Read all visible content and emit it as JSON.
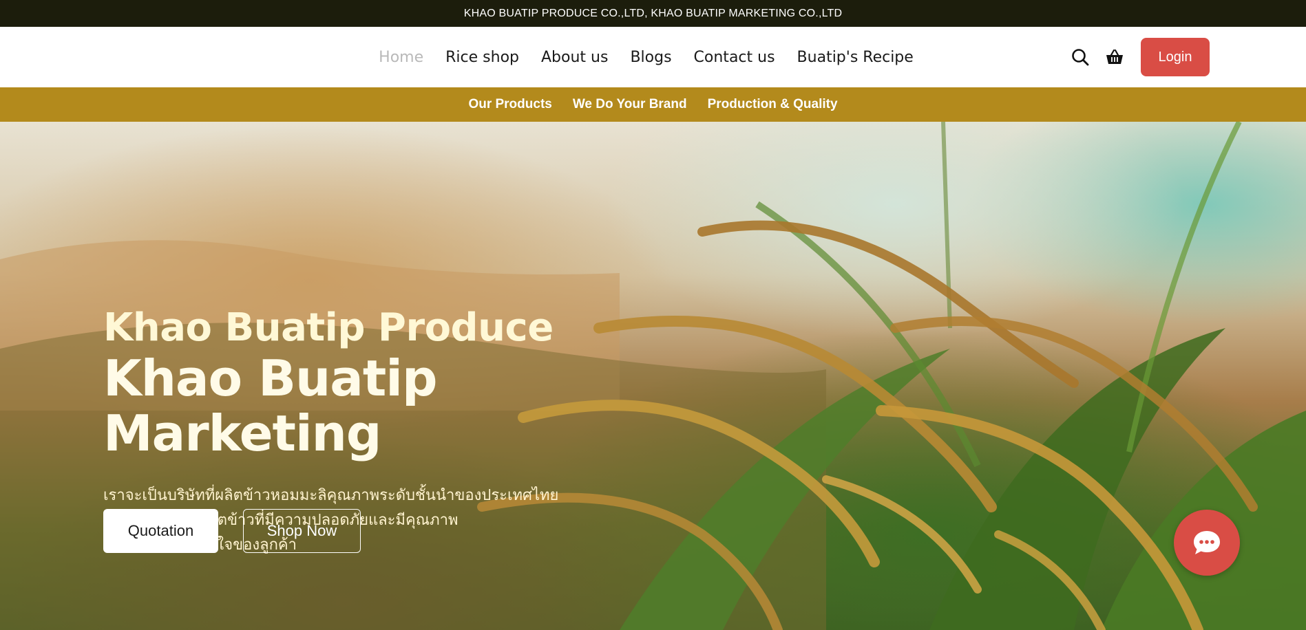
{
  "topbar": {
    "text": "KHAO BUATIP PRODUCE CO.,LTD, KHAO BUATIP MARKETING CO.,LTD"
  },
  "nav": {
    "links": [
      {
        "label": "Home",
        "active": true
      },
      {
        "label": "Rice shop"
      },
      {
        "label": "About us"
      },
      {
        "label": "Blogs"
      },
      {
        "label": "Contact us"
      },
      {
        "label": "Buatip's Recipe"
      }
    ],
    "search_icon": "search-icon",
    "cart_icon": "basket-icon",
    "login_label": "Login"
  },
  "subnav": {
    "links": [
      {
        "label": "Our Products"
      },
      {
        "label": "We Do Your Brand"
      },
      {
        "label": "Production & Quality"
      }
    ]
  },
  "hero": {
    "title_line1": "Khao Buatip Produce",
    "title_line2": "Khao Buatip Marketing",
    "description_lines": [
      "เราจะเป็นบริษัทที่ผลิตข้าวหอมมะลิคุณภาพระดับชั้นนำของประเทศไทย",
      "โดยมุ่งเน้นการผลิตข้าวที่มีความปลอดภัยและมีคุณภาพ",
      "เพื่อให้เป็นที่พึงพอใจของลูกค้า"
    ],
    "quotation_label": "Quotation",
    "shop_label": "Shop Now"
  },
  "chat": {
    "icon": "chat-bubble-icon"
  },
  "colors": {
    "topbar_bg": "#1c1d0c",
    "subnav_bg": "#b38a1c",
    "accent_red": "#d94d45",
    "hero_title": "#fff8d6"
  }
}
